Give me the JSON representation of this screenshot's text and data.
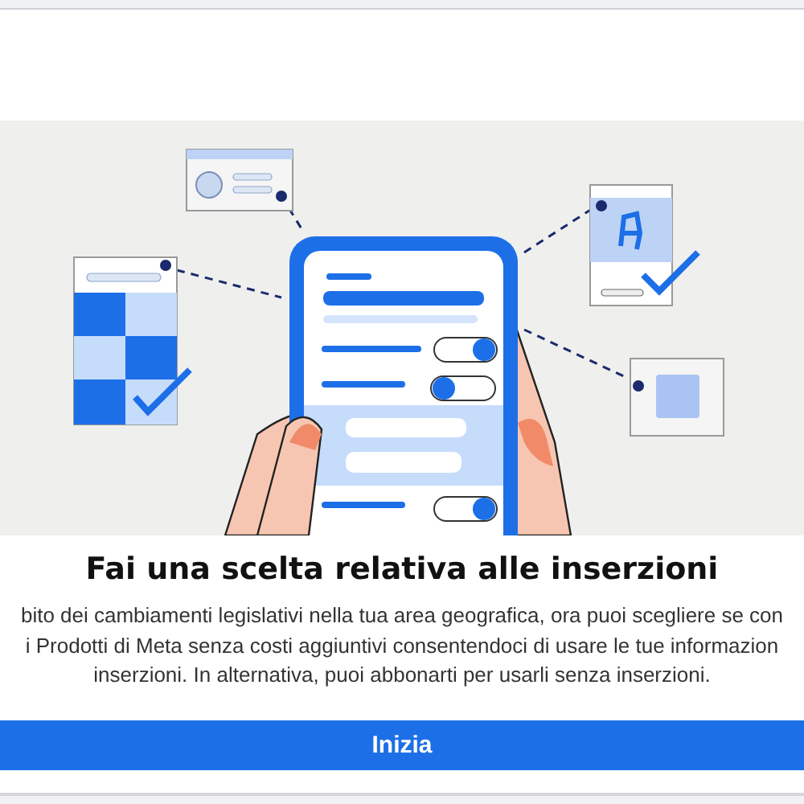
{
  "dialog": {
    "title": "Fai una scelta relativa alle inserzioni",
    "body_lines": [
      "bito dei cambiamenti legislativi nella tua area geografica, ora puoi scegliere se con",
      "i Prodotti di Meta senza costi aggiuntivi consentendoci di usare le tue informazion",
      "inserzioni. In alternativa, puoi abbonarti per usarli senza inserzioni."
    ],
    "button": "Inizia"
  }
}
